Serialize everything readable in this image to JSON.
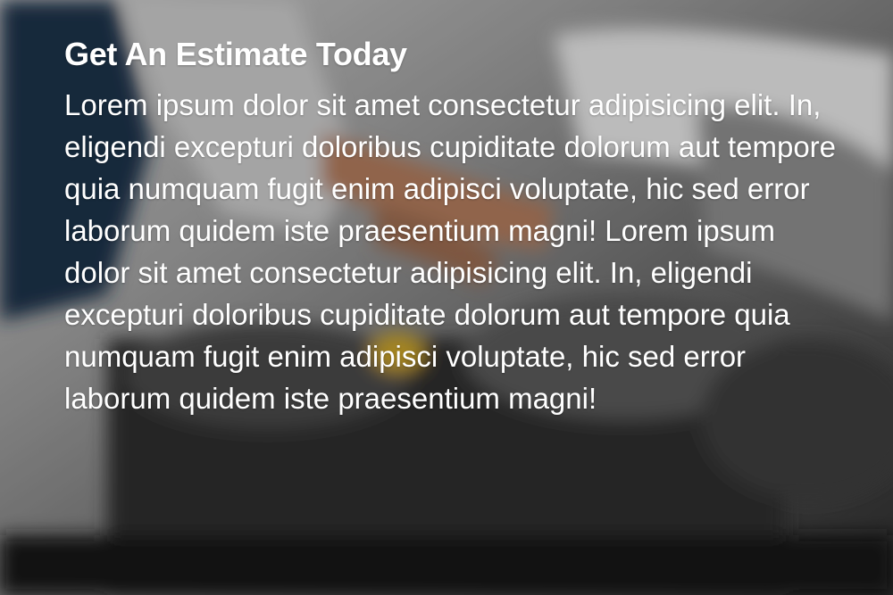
{
  "estimate": {
    "title": "Get An Estimate Today",
    "body": "Lorem ipsum dolor sit amet consectetur adipisicing elit. In, eligendi excepturi doloribus cupiditate dolorum aut tempore quia numquam fugit enim adipisci voluptate, hic sed error laborum quidem iste praesentium magni! Lorem ipsum dolor sit amet consectetur adipisicing elit. In, eligendi excepturi doloribus cupiditate dolorum aut tempore quia numquam fugit enim adipisci voluptate, hic sed error laborum quidem iste praesentium magni!"
  },
  "colors": {
    "text": "#ffffff",
    "overlay": "#000000"
  }
}
